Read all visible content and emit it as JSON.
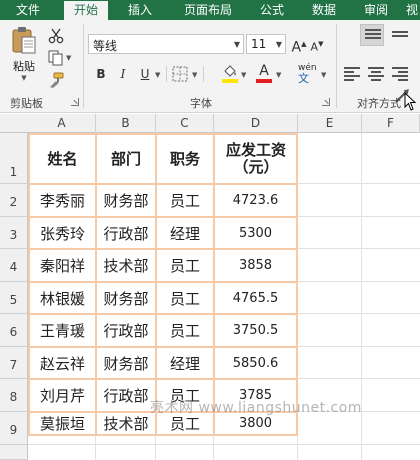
{
  "tabs": [
    {
      "label": "文件",
      "active": false
    },
    {
      "label": "开始",
      "active": true
    },
    {
      "label": "插入",
      "active": false
    },
    {
      "label": "页面布局",
      "active": false
    },
    {
      "label": "公式",
      "active": false
    },
    {
      "label": "数据",
      "active": false
    },
    {
      "label": "审阅",
      "active": false
    },
    {
      "label": "视",
      "active": false
    }
  ],
  "ribbon": {
    "clipboard": {
      "paste_label": "粘贴",
      "group_label": "剪贴板"
    },
    "font": {
      "font_name": "等线",
      "font_size": "11",
      "grow_label": "A",
      "shrink_label": "A",
      "bold_label": "B",
      "italic_label": "I",
      "underline_label": "U",
      "font_color_label": "A",
      "phonetic_label": "wén",
      "group_label": "字体"
    },
    "alignment": {
      "group_label": "对齐方式"
    },
    "colors": {
      "fill": "#ffe600",
      "font_color": "#e21f1f",
      "accent": "#217346"
    }
  },
  "columns": [
    "A",
    "B",
    "C",
    "D",
    "E",
    "F"
  ],
  "rows": [
    "1",
    "2",
    "3",
    "4",
    "5",
    "6",
    "7",
    "8",
    "9"
  ],
  "table": {
    "headers": [
      "姓名",
      "部门",
      "职务",
      "应发工资（元）"
    ],
    "rows": [
      [
        "李秀丽",
        "财务部",
        "员工",
        "4723.6"
      ],
      [
        "张秀玲",
        "行政部",
        "经理",
        "5300"
      ],
      [
        "秦阳祥",
        "技术部",
        "员工",
        "3858"
      ],
      [
        "林银媛",
        "财务部",
        "员工",
        "4765.5"
      ],
      [
        "王青瑗",
        "行政部",
        "员工",
        "3750.5"
      ],
      [
        "赵云祥",
        "财务部",
        "经理",
        "5850.6"
      ],
      [
        "刘月芹",
        "行政部",
        "员工",
        "3785"
      ],
      [
        "莫振垣",
        "技术部",
        "员工",
        "3800"
      ]
    ]
  },
  "watermark": "亮术网 www.liangshunet.com"
}
